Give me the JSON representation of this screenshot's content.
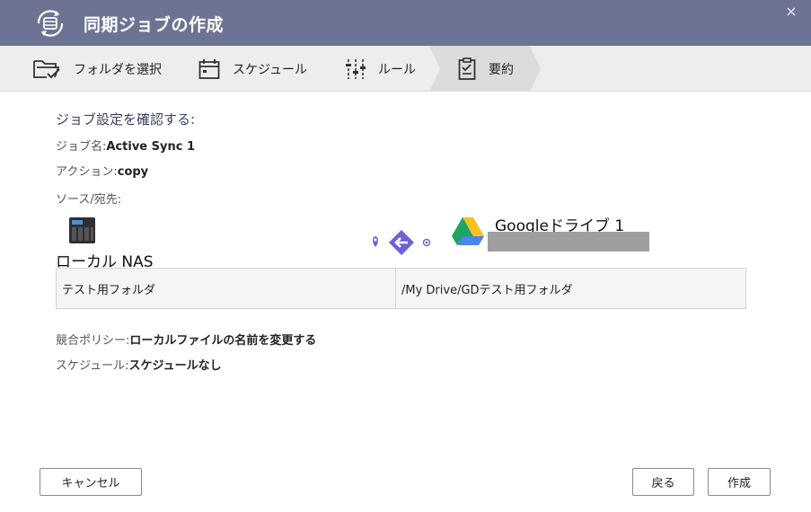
{
  "window": {
    "title": "同期ジョブの作成",
    "close_glyph": "×",
    "icon": "sync-job-icon"
  },
  "steps": [
    {
      "label": "フォルダを選択",
      "icon": "folder-check-icon"
    },
    {
      "label": "スケジュール",
      "icon": "calendar-icon"
    },
    {
      "label": "ルール",
      "icon": "sliders-icon"
    },
    {
      "label": "要約",
      "icon": "clipboard-icon",
      "active": true
    }
  ],
  "summary": {
    "heading": "ジョブ設定を確認する:",
    "job_name_key": "ジョブ名:",
    "job_name_value": "Active Sync 1",
    "action_key": "アクション:",
    "action_value": "copy",
    "source_dest_key": "ソース/宛先:",
    "source_label": "ローカル NAS",
    "dest_label": "Googleドライブ 1",
    "source_path": "テスト用フォルダ",
    "dest_path": "/My Drive/GDテスト用フォルダ",
    "conflict_key": "競合ポリシー:",
    "conflict_value": "ローカルファイルの名前を変更する",
    "schedule_key": "スケジュール:",
    "schedule_value": "スケジュールなし"
  },
  "buttons": {
    "cancel": "キャンセル",
    "back": "戻る",
    "create": "作成"
  },
  "colors": {
    "titlebar": "#6d7493",
    "accent_purple": "#6b63d6",
    "stepbar": "#ededed"
  }
}
